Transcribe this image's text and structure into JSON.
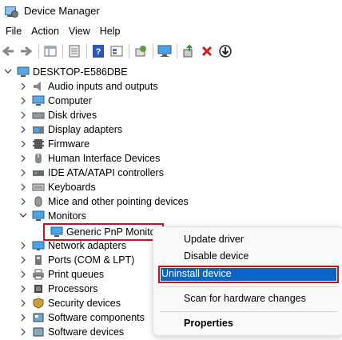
{
  "window": {
    "title": "Device Manager"
  },
  "menu": [
    "File",
    "Action",
    "View",
    "Help"
  ],
  "toolbar": [
    "back-arrow-icon",
    "forward-arrow-icon",
    "show-hide-tree-icon",
    "properties-icon",
    "help-icon",
    "view-icon",
    "scan-changes-icon",
    "monitor-icon",
    "update-driver-icon",
    "uninstall-x-icon",
    "disable-down-icon"
  ],
  "tree": {
    "root": "DESKTOP-E586DBE",
    "items": [
      {
        "label": "Audio inputs and outputs",
        "icon": "speaker-icon"
      },
      {
        "label": "Computer",
        "icon": "computer-icon"
      },
      {
        "label": "Disk drives",
        "icon": "disk-drive-icon"
      },
      {
        "label": "Display adapters",
        "icon": "display-adapter-icon"
      },
      {
        "label": "Firmware",
        "icon": "firmware-icon"
      },
      {
        "label": "Human Interface Devices",
        "icon": "hid-icon"
      },
      {
        "label": "IDE ATA/ATAPI controllers",
        "icon": "ide-controller-icon"
      },
      {
        "label": "Keyboards",
        "icon": "keyboard-icon"
      },
      {
        "label": "Mice and other pointing devices",
        "icon": "mouse-icon"
      },
      {
        "label": "Monitors",
        "icon": "monitor-icon",
        "expanded": true
      },
      {
        "label": "Generic PnP Monitor",
        "icon": "monitor-icon",
        "child": true,
        "selected": true
      },
      {
        "label": "Network adapters",
        "icon": "network-adapter-icon"
      },
      {
        "label": "Ports (COM & LPT)",
        "icon": "port-icon"
      },
      {
        "label": "Print queues",
        "icon": "printer-icon"
      },
      {
        "label": "Processors",
        "icon": "processor-icon"
      },
      {
        "label": "Security devices",
        "icon": "security-icon"
      },
      {
        "label": "Software components",
        "icon": "software-component-icon"
      },
      {
        "label": "Software devices",
        "icon": "software-device-icon"
      }
    ]
  },
  "context_menu": {
    "items": [
      "Update driver",
      "Disable device",
      "Uninstall device",
      "Scan for hardware changes",
      "Properties"
    ],
    "highlighted": "Uninstall device"
  },
  "colors": {
    "accent": "#0a64c8",
    "highlight_border": "#c0181f"
  }
}
